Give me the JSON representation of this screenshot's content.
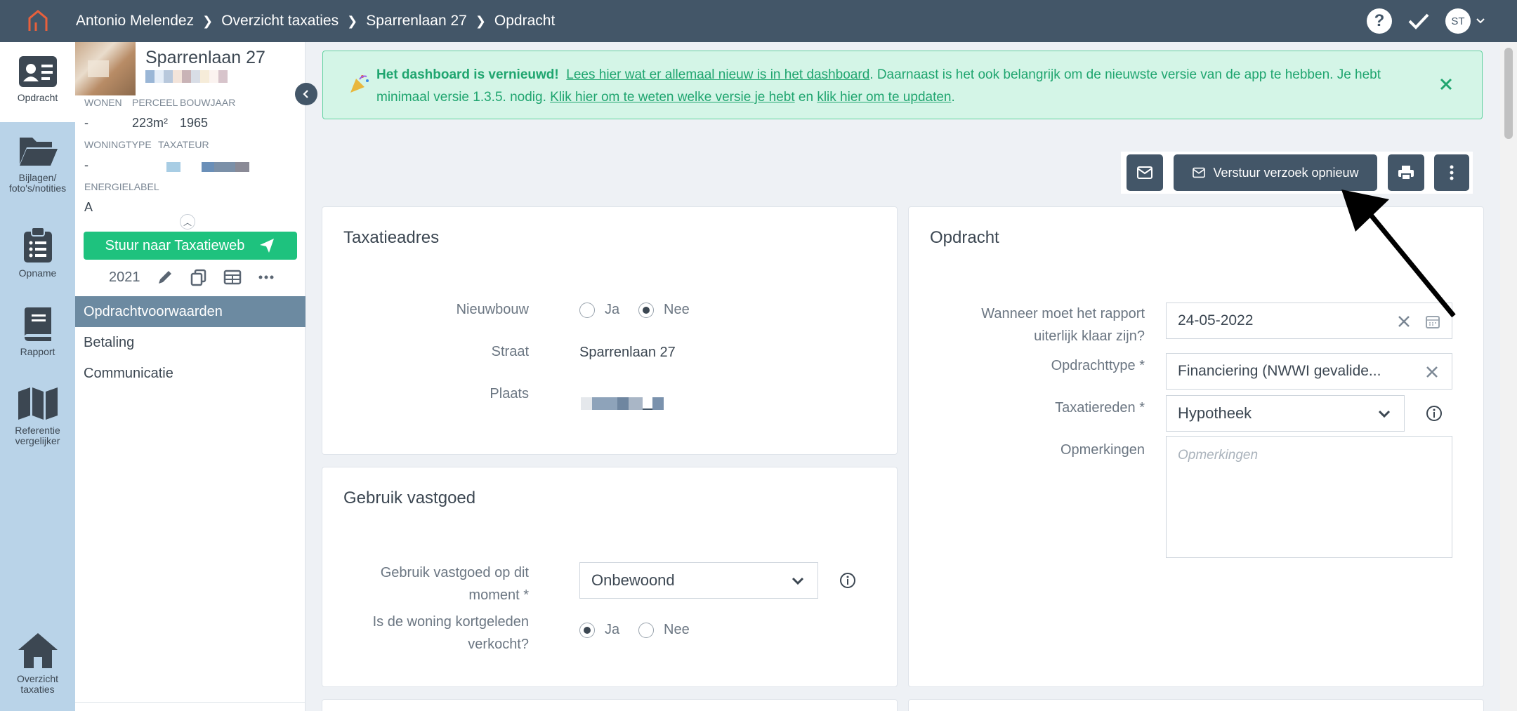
{
  "topbar": {
    "breadcrumb": [
      "Antonio Melendez",
      "Overzicht taxaties",
      "Sparrenlaan 27",
      "Opdracht"
    ],
    "help": "?",
    "avatar_initials": "ST"
  },
  "rail": {
    "items": [
      {
        "label": "Opdracht",
        "icon": "id-card-icon"
      },
      {
        "label": "Bijlagen/ foto's/notities",
        "icon": "folder-open-icon"
      },
      {
        "label": "Opname",
        "icon": "clipboard-list-icon"
      },
      {
        "label": "Rapport",
        "icon": "book-icon"
      },
      {
        "label": "Referentie vergelijker",
        "icon": "map-icon"
      },
      {
        "label": "Overzicht taxaties",
        "icon": "home-icon"
      }
    ]
  },
  "property": {
    "title": "Sparrenlaan 27",
    "wonen_label": "WONEN",
    "wonen_value": "-",
    "perceel_label": "PERCEEL",
    "perceel_value": "223m²",
    "bouwjaar_label": "BOUWJAAR",
    "bouwjaar_value": "1965",
    "woningtype_label": "WONINGTYPE",
    "woningtype_value": "-",
    "taxateur_label": "TAXATEUR",
    "energielabel_label": "ENERGIELABEL",
    "energielabel_value": "A",
    "send_button": "Stuur naar Taxatieweb",
    "year": "2021",
    "menu": [
      "Opdrachtvoorwaarden",
      "Betaling",
      "Communicatie"
    ]
  },
  "notice": {
    "bold": "Het dashboard is vernieuwd!",
    "link1": "Lees hier wat er allemaal nieuw is in het dashboard",
    "text1": ". Daarnaast is het ook belangrijk om de nieuwste versie van de app te hebben. Je hebt minimaal versie 1.3.5. nodig.",
    "link2": "Klik hier om te weten welke versie je hebt",
    "text2": "en",
    "link3": "klik hier om te updaten",
    "text3": "."
  },
  "toolbar": {
    "resend_label": "Verstuur verzoek opnieuw"
  },
  "taxatieadres": {
    "title": "Taxatieadres",
    "nieuwbouw_label": "Nieuwbouw",
    "ja": "Ja",
    "nee": "Nee",
    "straat_label": "Straat",
    "straat_value": "Sparrenlaan 27",
    "plaats_label": "Plaats"
  },
  "gebruik": {
    "title": "Gebruik vastgoed",
    "gebruik_label": "Gebruik vastgoed op dit moment *",
    "gebruik_value": "Onbewoond",
    "verkocht_label": "Is de woning kortgeleden verkocht?",
    "ja": "Ja",
    "nee": "Nee"
  },
  "opdracht": {
    "title": "Opdracht",
    "datum_label": "Wanneer moet het rapport uiterlijk klaar zijn?",
    "datum_value": "24-05-2022",
    "type_label": "Opdrachttype *",
    "type_value": "Financiering (NWWI gevalide...",
    "reden_label": "Taxatiereden *",
    "reden_value": "Hypotheek",
    "opm_label": "Opmerkingen",
    "opm_placeholder": "Opmerkingen"
  },
  "colors": {
    "topbar": "#435668",
    "rail": "#b9d3e8",
    "accent_green": "#1ec27e",
    "notice_bg": "#d4f5e7",
    "active_menu": "#6c8aa1"
  }
}
